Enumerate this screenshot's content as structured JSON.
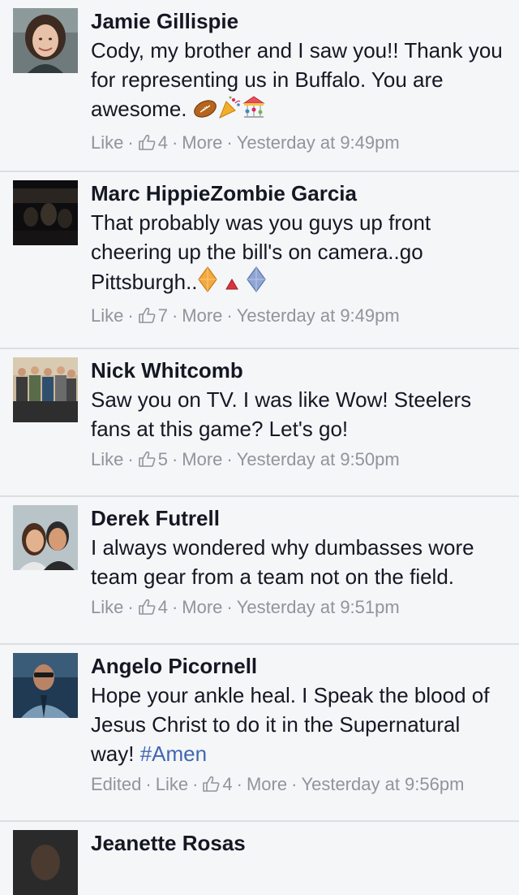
{
  "comments": [
    {
      "name": "Jamie Gillispie",
      "text": "Cody, my brother and I saw you!! Thank you for representing us in Buffalo. You are awesome.",
      "emojis": [
        "football-icon",
        "party-popper-icon",
        "carousel-icon"
      ],
      "like": "Like",
      "likes": "4",
      "more": "More",
      "time": "Yesterday at 9:49pm"
    },
    {
      "name": "Marc HippieZombie Garcia",
      "text": "That probably was you guys up front cheering up the bill's on camera..go Pittsburgh..",
      "emojis": [
        "orange-diamond-icon",
        "red-triangle-icon",
        "blue-diamond-icon"
      ],
      "like": "Like",
      "likes": "7",
      "more": "More",
      "time": "Yesterday at 9:49pm"
    },
    {
      "name": "Nick Whitcomb",
      "text": "Saw you on TV. I was like Wow! Steelers fans at this game? Let's go!",
      "like": "Like",
      "likes": "5",
      "more": "More",
      "time": "Yesterday at 9:50pm"
    },
    {
      "name": "Derek Futrell",
      "text": "I always wondered why dumbasses wore team gear from a team not on the field.",
      "like": "Like",
      "likes": "4",
      "more": "More",
      "time": "Yesterday at 9:51pm"
    },
    {
      "name": "Angelo Picornell",
      "text": "Hope your ankle heal. I Speak the blood of Jesus Christ to do it in the Supernatural way!",
      "hashtag": "#Amen",
      "edited": "Edited",
      "like": "Like",
      "likes": "4",
      "more": "More",
      "time": "Yesterday at 9:56pm"
    },
    {
      "name": "Jeanette Rosas"
    }
  ],
  "colors": {
    "background": "#f5f6f8",
    "divider": "#dcdee3",
    "name": "#141823",
    "meta": "#90949c",
    "hashtag": "#4267b2"
  }
}
